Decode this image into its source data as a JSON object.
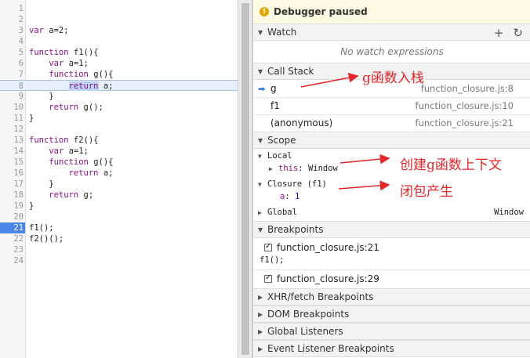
{
  "editor": {
    "lines": [
      {
        "n": "1",
        "code": ""
      },
      {
        "n": "2",
        "code": ""
      },
      {
        "n": "3",
        "code": "var a=2;"
      },
      {
        "n": "4",
        "code": ""
      },
      {
        "n": "5",
        "code": "function f1(){"
      },
      {
        "n": "6",
        "code": "    var a=1;"
      },
      {
        "n": "7",
        "code": "    function g(){"
      },
      {
        "n": "8",
        "code": "        return a;"
      },
      {
        "n": "9",
        "code": "    }"
      },
      {
        "n": "10",
        "code": "    return g();"
      },
      {
        "n": "11",
        "code": "}"
      },
      {
        "n": "12",
        "code": ""
      },
      {
        "n": "13",
        "code": "function f2(){"
      },
      {
        "n": "14",
        "code": "    var a=1;"
      },
      {
        "n": "15",
        "code": "    function g(){"
      },
      {
        "n": "16",
        "code": "        return a;"
      },
      {
        "n": "17",
        "code": "    }"
      },
      {
        "n": "18",
        "code": "    return g;"
      },
      {
        "n": "19",
        "code": "}"
      },
      {
        "n": "20",
        "code": ""
      },
      {
        "n": "21",
        "code": "f1();"
      },
      {
        "n": "22",
        "code": "f2()();"
      },
      {
        "n": "23",
        "code": ""
      },
      {
        "n": "24",
        "code": ""
      }
    ],
    "current_line": "8",
    "breakpoint_line": "21"
  },
  "sidebar": {
    "paused_label": "Debugger paused",
    "paused_icon": "info-icon",
    "watch": {
      "title": "Watch",
      "empty": "No watch expressions",
      "add_icon": "plus-icon",
      "refresh_icon": "refresh-icon"
    },
    "call_stack": {
      "title": "Call Stack",
      "frames": [
        {
          "name": "g",
          "location": "function_closure.js:8"
        },
        {
          "name": "f1",
          "location": "function_closure.js:10"
        },
        {
          "name": "(anonymous)",
          "location": "function_closure.js:21"
        }
      ]
    },
    "scope": {
      "title": "Scope",
      "local_label": "Local",
      "local_this_key": "this",
      "local_this_value": "Window",
      "closure_label": "Closure (f1)",
      "closure_key": "a",
      "closure_value": "1",
      "global_label": "Global",
      "global_value": "Window"
    },
    "breakpoints": {
      "title": "Breakpoints",
      "items": [
        {
          "location": "function_closure.js:21",
          "code": "f1();"
        },
        {
          "location": "function_closure.js:29",
          "code": ""
        }
      ]
    },
    "collapsed_sections": [
      "XHR/fetch Breakpoints",
      "DOM Breakpoints",
      "Global Listeners",
      "Event Listener Breakpoints"
    ]
  },
  "annotations": {
    "call_stack_note": "g函数入栈",
    "local_note": "创建g函数上下文",
    "closure_note": "闭包产生",
    "color": "#e3262a"
  }
}
